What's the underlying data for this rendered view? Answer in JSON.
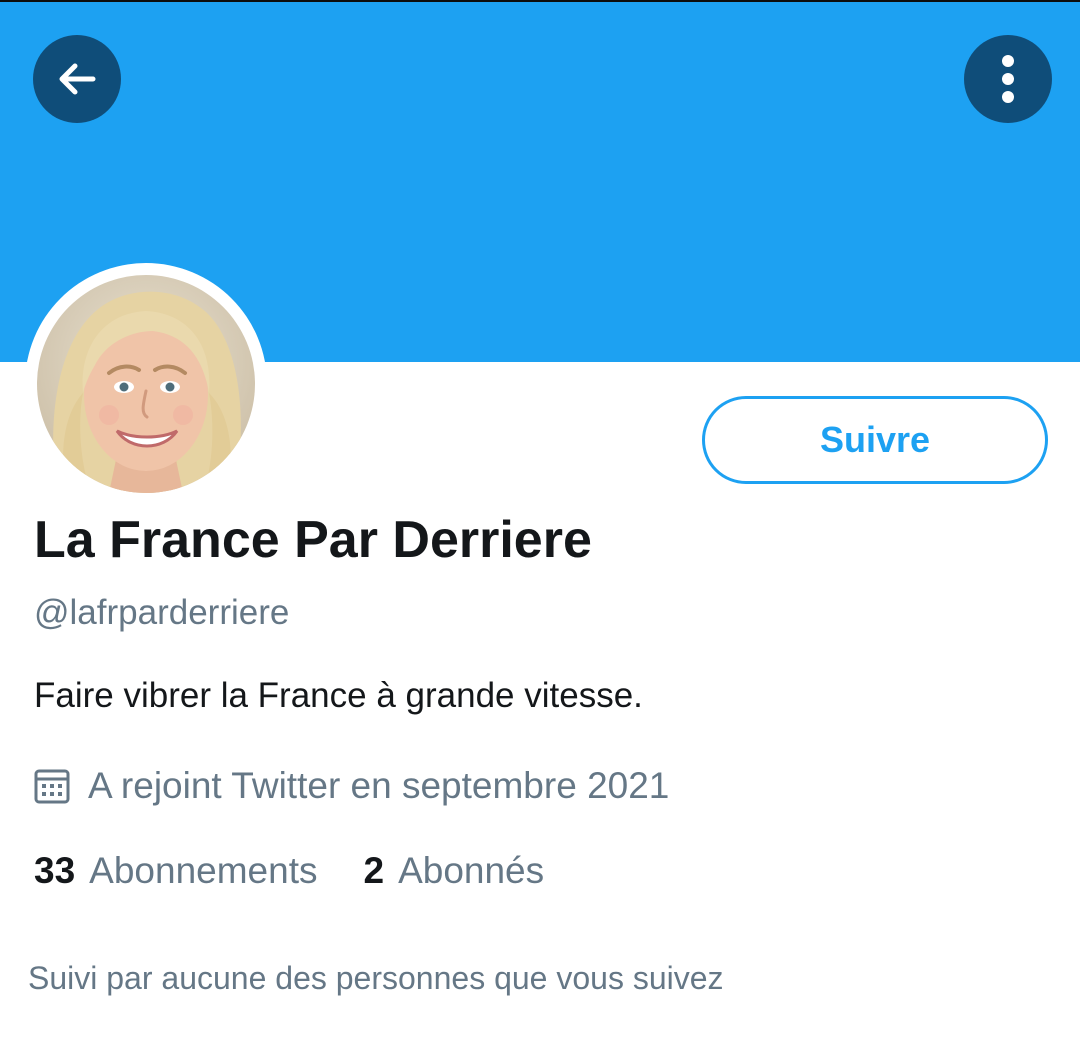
{
  "header": {
    "back_icon": "arrow-left-icon",
    "more_icon": "more-vertical-icon",
    "banner_color": "#1da1f2",
    "button_color": "#0f4d79"
  },
  "profile": {
    "display_name": "La France Par Derriere",
    "handle": "@lafrparderriere",
    "bio": "Faire vibrer la France à grande vitesse.",
    "joined_icon": "calendar-icon",
    "joined": "A rejoint Twitter en septembre 2021",
    "follow_label": "Suivre",
    "accent_color": "#1da1f2"
  },
  "stats": [
    {
      "count": "33",
      "label": "Abonnements"
    },
    {
      "count": "2",
      "label": "Abonnés"
    }
  ],
  "followed_by": "Suivi par aucune des personnes que vous suivez"
}
